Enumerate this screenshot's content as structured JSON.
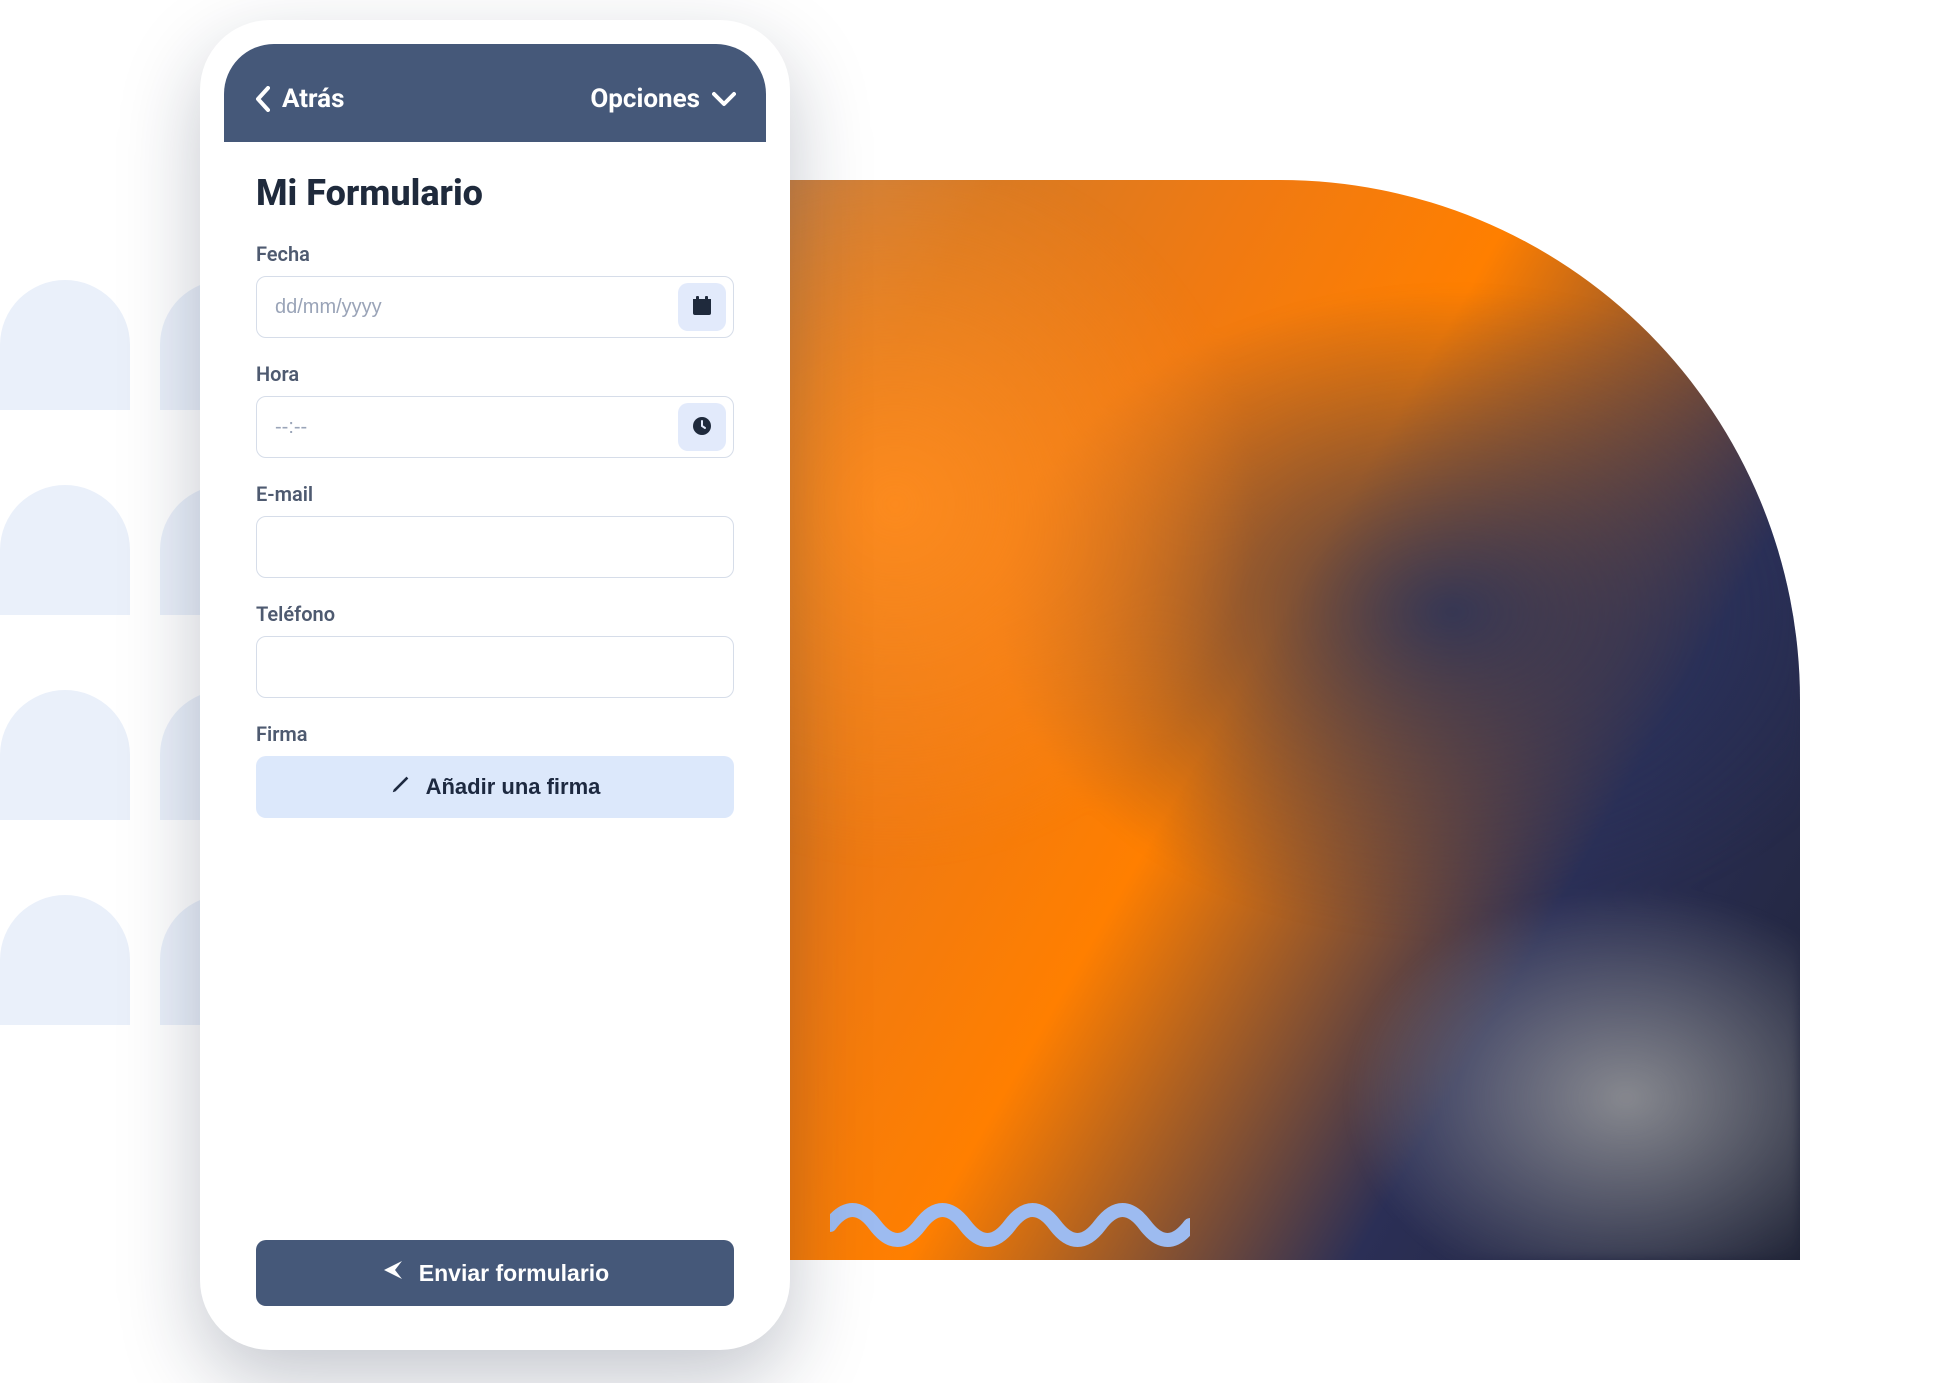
{
  "header": {
    "back_label": "Atrás",
    "options_label": "Opciones"
  },
  "form": {
    "title": "Mi Formulario",
    "fields": {
      "date": {
        "label": "Fecha",
        "placeholder": "dd/mm/yyyy",
        "value": ""
      },
      "time": {
        "label": "Hora",
        "placeholder": "--:--",
        "value": ""
      },
      "email": {
        "label": "E-mail",
        "placeholder": "",
        "value": ""
      },
      "phone": {
        "label": "Teléfono",
        "placeholder": "",
        "value": ""
      },
      "signature": {
        "label": "Firma",
        "button": "Añadir una firma"
      }
    },
    "submit_label": "Enviar formulario"
  },
  "colors": {
    "header_bg": "#455879",
    "accent_light": "#DCE8FB",
    "input_icon_bg": "#E2EAFB",
    "arch": "#EAF0FA",
    "wave": "#9DBBF0"
  },
  "icons": {
    "chevron_left": "chevron-left-icon",
    "chevron_down": "chevron-down-icon",
    "calendar": "calendar-icon",
    "clock": "clock-icon",
    "pencil": "pencil-icon",
    "send": "send-icon"
  }
}
